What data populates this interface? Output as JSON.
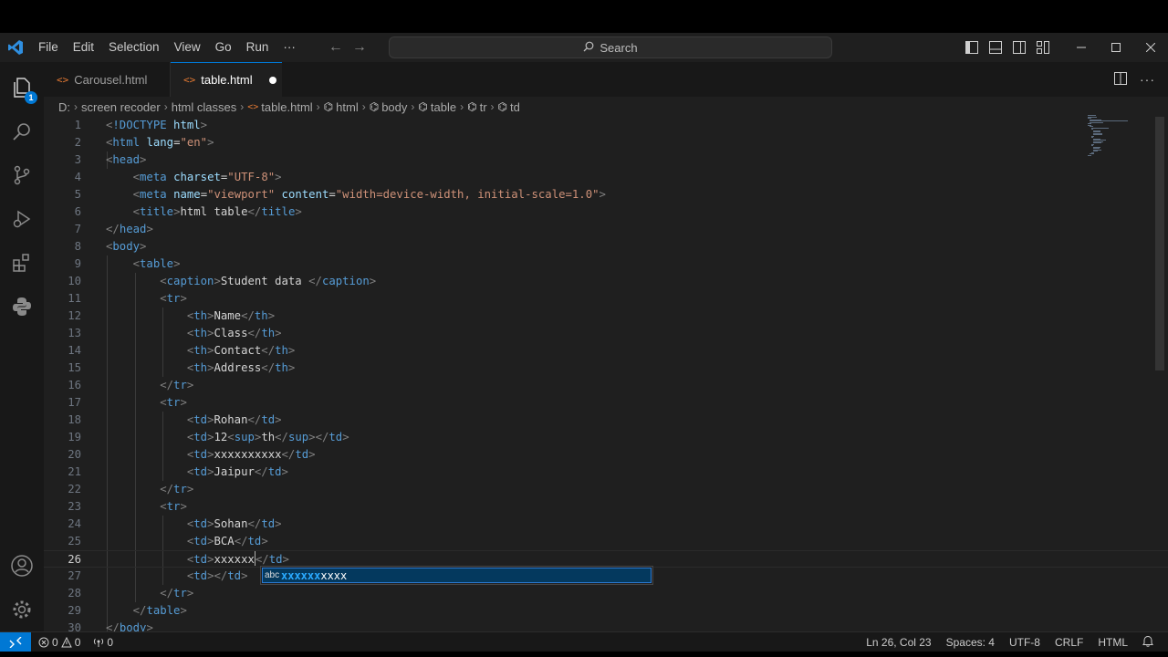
{
  "menu": [
    "File",
    "Edit",
    "Selection",
    "View",
    "Go",
    "Run",
    "···"
  ],
  "search": {
    "label": "Search"
  },
  "tabs": [
    {
      "label": "Carousel.html",
      "active": false,
      "dirty": false
    },
    {
      "label": "table.html",
      "active": true,
      "dirty": true
    }
  ],
  "breadcrumb": [
    "D:",
    "screen recoder",
    "html classes",
    "table.html",
    "html",
    "body",
    "table",
    "tr",
    "td"
  ],
  "explorer_badge": "1",
  "icons": [
    "vscode-logo-icon",
    "explorer-icon",
    "search-icon",
    "source-control-icon",
    "run-debug-icon",
    "extensions-icon",
    "python-icon",
    "account-icon",
    "settings-icon",
    "remote-icon"
  ],
  "editor": {
    "current_line": 26,
    "lines": [
      {
        "n": "1",
        "text": "<!DOCTYPE html>"
      },
      {
        "n": "2",
        "text": "<html lang=\"en\">"
      },
      {
        "n": "3",
        "text": "<head>"
      },
      {
        "n": "4",
        "text": "    <meta charset=\"UTF-8\">"
      },
      {
        "n": "5",
        "text": "    <meta name=\"viewport\" content=\"width=device-width, initial-scale=1.0\">"
      },
      {
        "n": "6",
        "text": "    <title>html table</title>"
      },
      {
        "n": "7",
        "text": "</head>"
      },
      {
        "n": "8",
        "text": "<body>"
      },
      {
        "n": "9",
        "text": "    <table>"
      },
      {
        "n": "10",
        "text": "        <caption>Student data </caption>"
      },
      {
        "n": "11",
        "text": "        <tr>"
      },
      {
        "n": "12",
        "text": "            <th>Name</th>"
      },
      {
        "n": "13",
        "text": "            <th>Class</th>"
      },
      {
        "n": "14",
        "text": "            <th>Contact</th>"
      },
      {
        "n": "15",
        "text": "            <th>Address</th>"
      },
      {
        "n": "16",
        "text": "        </tr>"
      },
      {
        "n": "17",
        "text": "        <tr>"
      },
      {
        "n": "18",
        "text": "            <td>Rohan</td>"
      },
      {
        "n": "19",
        "text": "            <td>12<sup>th</sup></td>"
      },
      {
        "n": "20",
        "text": "            <td>xxxxxxxxxx</td>"
      },
      {
        "n": "21",
        "text": "            <td>Jaipur</td>"
      },
      {
        "n": "22",
        "text": "        </tr>"
      },
      {
        "n": "23",
        "text": "        <tr>"
      },
      {
        "n": "24",
        "text": "            <td>Sohan</td>"
      },
      {
        "n": "25",
        "text": "            <td>BCA</td>"
      },
      {
        "n": "26",
        "text": "            <td>xxxxxx</td>"
      },
      {
        "n": "27",
        "text": "            <td></td>"
      },
      {
        "n": "28",
        "text": "        </tr>"
      },
      {
        "n": "29",
        "text": "    </table>"
      },
      {
        "n": "30",
        "text": "</body>"
      }
    ]
  },
  "suggestion": {
    "kind": "abc",
    "match": "xxxxxx",
    "rest": "xxxx"
  },
  "status": {
    "errors": "0",
    "warnings": "0",
    "ports": "0",
    "cursor": "Ln 26, Col 23",
    "indent": "Spaces: 4",
    "encoding": "UTF-8",
    "eol": "CRLF",
    "language": "HTML"
  },
  "colors": {
    "accent": "#0078d4",
    "tag": "#569cd6",
    "attr": "#9cdcfe",
    "string": "#ce9178",
    "bracket": "#808080",
    "html_icon": "#e37933"
  }
}
